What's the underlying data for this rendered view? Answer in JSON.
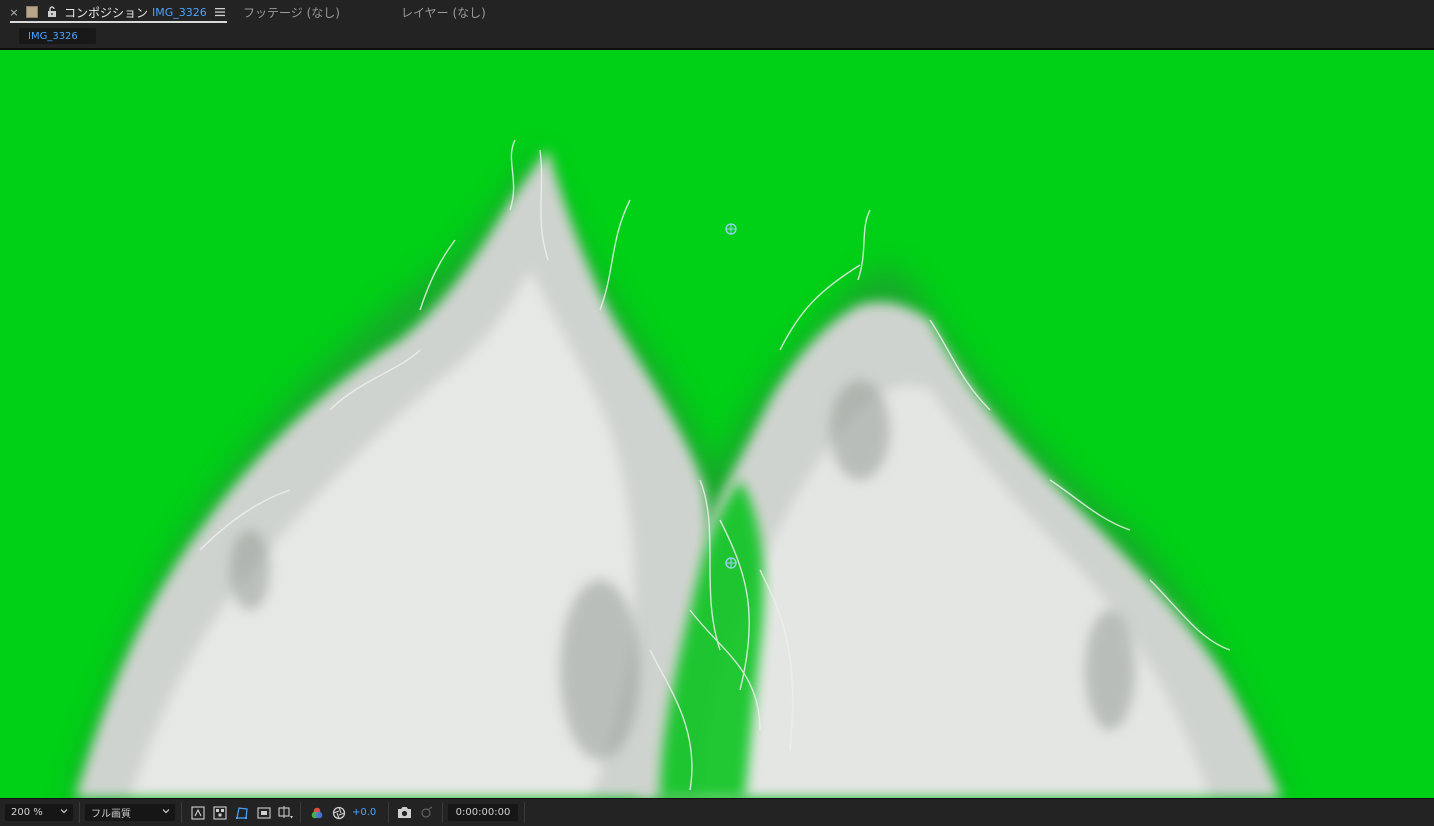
{
  "tabs": {
    "composition_label": "コンポジション",
    "composition_name": "IMG_3326",
    "footage_label": "フッテージ (なし)",
    "layer_label": "レイヤー (なし)"
  },
  "subtab": {
    "label": "IMG_3326"
  },
  "viewer": {
    "background_color": "#00d016"
  },
  "toolbar": {
    "zoom": "200 %",
    "resolution": "フル画質",
    "exposure": "+0.0",
    "timecode": "0:00:00:00"
  },
  "colors": {
    "accent_blue": "#4aa3ff",
    "panel": "#232323"
  }
}
